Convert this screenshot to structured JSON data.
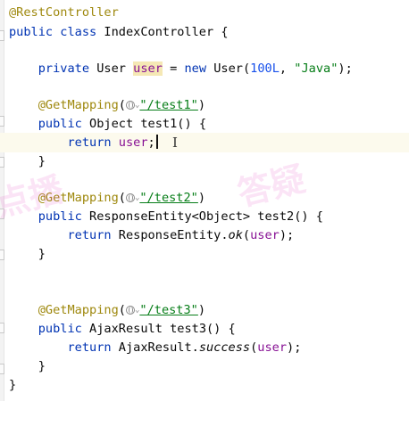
{
  "editor": {
    "class_annotation": "@RestController",
    "class_decl": {
      "mod1": "public",
      "mod2": "class",
      "name": "IndexController",
      "brace": " {"
    },
    "field": {
      "modifier": "private",
      "type": "User",
      "name": "user",
      "eq": " = ",
      "new_kw": "new",
      "ctor": " User(",
      "num": "100L",
      "sep": ", ",
      "str": "\"Java\"",
      "end": ");"
    },
    "methods": [
      {
        "annotation": "@GetMapping",
        "path": "\"/test1\"",
        "modifier": "public",
        "return_type": "Object",
        "name": "test1",
        "params": "() {",
        "return_kw": "return",
        "return_expr_field": "user",
        "return_expr_end": ";"
      },
      {
        "annotation": "@GetMapping",
        "path": "\"/test2\"",
        "modifier": "public",
        "return_type": "ResponseEntity<Object>",
        "name": "test2",
        "params": "() {",
        "return_kw": "return",
        "return_class": "ResponseEntity.",
        "return_call": "ok",
        "return_arg_open": "(",
        "return_arg": "user",
        "return_arg_close": ");"
      },
      {
        "annotation": "@GetMapping",
        "path": "\"/test3\"",
        "modifier": "public",
        "return_type": "AjaxResult",
        "name": "test3",
        "params": "() {",
        "return_kw": "return",
        "return_class": "AjaxResult.",
        "return_call": "success",
        "return_arg_open": "(",
        "return_arg": "user",
        "return_arg_close": ");"
      }
    ],
    "brace_close": "}",
    "paren_open": "(",
    "paren_close": ")",
    "chevron": "⌄",
    "cursor_glyph": "I"
  },
  "watermark": {
    "left": "点播",
    "mid": "答疑"
  },
  "colors": {
    "annotation": "#9e880d",
    "keyword": "#0033b3",
    "field": "#871094",
    "number": "#1750eb",
    "string": "#067d17",
    "current_line": "#fcfaed"
  }
}
